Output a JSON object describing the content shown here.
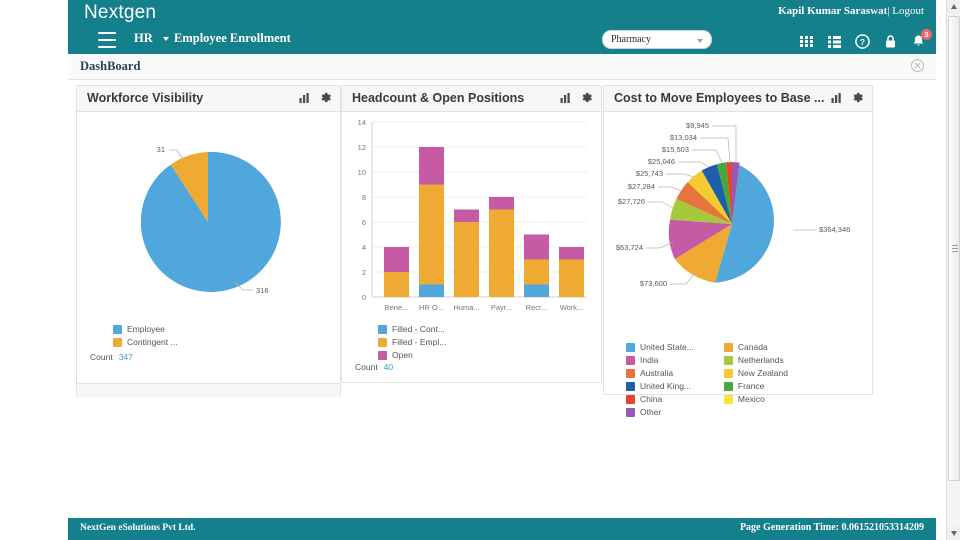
{
  "header": {
    "brand": "Nextgen",
    "user_name": "Kapil Kumar Saraswat",
    "separator": "|",
    "logout": "Logout",
    "menu_hr": "HR",
    "menu_employee_enrollment": "Employee Enrollment",
    "module_select_value": "Pharmacy",
    "notification_count": "3",
    "accent_color": "#14808c"
  },
  "page": {
    "title": "DashBoard"
  },
  "panels": {
    "workforce": {
      "title": "Workforce Visibility",
      "count_label": "Count",
      "count_value": "347",
      "legend": [
        {
          "label": "Employee",
          "color": "#4fa7dc"
        },
        {
          "label": "Contingent ...",
          "color": "#efaa34"
        }
      ]
    },
    "headcount": {
      "title": "Headcount & Open Positions",
      "count_label": "Count",
      "count_value": "40",
      "legend": [
        {
          "label": "Filled - Cont...",
          "color": "#4fa7dc"
        },
        {
          "label": "Filled - Empl...",
          "color": "#efaa34"
        },
        {
          "label": "Open",
          "color": "#c75aa4"
        }
      ]
    },
    "cost": {
      "title": "Cost to Move Employees to Base ...",
      "legend_col1": [
        {
          "label": "United State...",
          "color": "#4fa7dc"
        },
        {
          "label": "India",
          "color": "#c75aa4"
        },
        {
          "label": "Australia",
          "color": "#e8743b"
        },
        {
          "label": "United King...",
          "color": "#1f5fa9"
        },
        {
          "label": "China",
          "color": "#e8432b"
        },
        {
          "label": "Other",
          "color": "#9b59b6"
        }
      ],
      "legend_col2": [
        {
          "label": "Canada",
          "color": "#efaa34"
        },
        {
          "label": "Netherlands",
          "color": "#a5c93b"
        },
        {
          "label": "New Zealand",
          "color": "#f2cb2f"
        },
        {
          "label": "France",
          "color": "#46a83c"
        },
        {
          "label": "Mexico",
          "color": "#f5e538"
        }
      ]
    }
  },
  "chart_data": [
    {
      "type": "pie",
      "title": "Workforce Visibility",
      "labels": [
        "Employee",
        "Contingent ..."
      ],
      "values": [
        316,
        31
      ],
      "value_labels": [
        "316",
        "31"
      ],
      "colors": [
        "#4fa7dc",
        "#efaa34"
      ],
      "total": 347,
      "legend_position": "bottom"
    },
    {
      "type": "bar",
      "title": "Headcount & Open Positions",
      "stacked": true,
      "categories": [
        "Bene...",
        "HR O...",
        "Huma...",
        "Payr...",
        "Recr...",
        "Work..."
      ],
      "series": [
        {
          "name": "Filled - Cont...",
          "color": "#4fa7dc",
          "values": [
            0,
            1,
            0,
            0,
            1,
            0
          ]
        },
        {
          "name": "Filled - Empl...",
          "color": "#efaa34",
          "values": [
            2,
            8,
            6,
            7,
            2,
            3
          ]
        },
        {
          "name": "Open",
          "color": "#c75aa4",
          "values": [
            2,
            3,
            1,
            1,
            2,
            1
          ]
        }
      ],
      "totals": [
        4,
        12,
        7,
        8,
        5,
        4
      ],
      "ylim": [
        0,
        14
      ],
      "yticks": [
        0,
        2,
        4,
        6,
        8,
        10,
        12,
        14
      ],
      "ytick_labels": [
        "0",
        "2",
        "4",
        "6",
        "8",
        "10",
        "12",
        "14"
      ],
      "xlabel": "",
      "ylabel": "",
      "grid": true,
      "legend_position": "bottom"
    },
    {
      "type": "pie",
      "title": "Cost to Move Employees to Base ...",
      "labels": [
        "United State...",
        "Canada",
        "India",
        "Netherlands",
        "Australia",
        "New Zealand",
        "United King...",
        "France",
        "China",
        "Mexico",
        "Other"
      ],
      "values": [
        364346,
        73600,
        63724,
        27726,
        27284,
        25743,
        25046,
        15503,
        13034,
        9945,
        22000
      ],
      "value_labels": [
        "$364,346",
        "$73,600",
        "$63,724",
        "$27,726",
        "$27,284",
        "$25,743",
        "$25,046",
        "$15,503",
        "$13,034",
        "$9,945"
      ],
      "colors": [
        "#4fa7dc",
        "#efaa34",
        "#c75aa4",
        "#a5c93b",
        "#e8743b",
        "#f2cb2f",
        "#1f5fa9",
        "#46a83c",
        "#e8432b",
        "#f5e538",
        "#9b59b6"
      ],
      "legend_position": "bottom"
    }
  ],
  "footer": {
    "company": "NextGen eSolutions Pvt Ltd.",
    "generation_time": "Page Generation Time: 0.061521053314209"
  }
}
